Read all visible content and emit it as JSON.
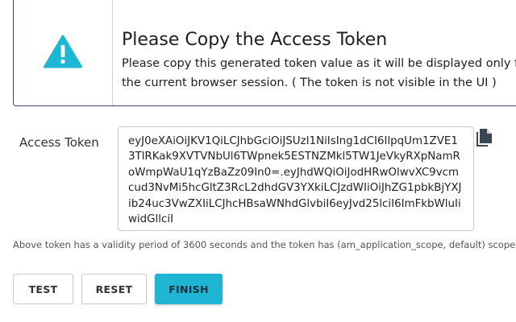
{
  "alert": {
    "icon": "warning-triangle-icon",
    "title": "Please Copy the Access Token",
    "message": "Please copy this generated token value as it will be displayed only for the current browser session. ( The token is not visible in the UI )",
    "accent_color": "#1fb6d3"
  },
  "token": {
    "label": "Access Token",
    "value": "eyJ0eXAiOiJKV1QiLCJhbGciOiJSUzI1NiIsIng1dCI6IlpqUm1ZVE13TlRKak9XVTVNbUl6TWpnek5ESTNZMkl5TW1JeVkyRXpNamRoWmpWaU1qYzBaZz09In0=.eyJhdWQiOiJodHRwOlwvXC9vcmcud3NvMi5hcGltZ3RcL2dhdGV3YXkiLCJzdWIiOiJhZG1pbkBjYXJib24uc3VwZXIiLCJhcHBsaWNhdGlvbiI6eyJvd25lciI6ImFkbWluIiwidGllciI",
    "copy_icon": "copy-icon",
    "validity_note": "Above token has a validity period of 3600 seconds and the token has (am_application_scope, default) scopes."
  },
  "buttons": {
    "test": "TEST",
    "reset": "RESET",
    "finish": "FINISH"
  }
}
